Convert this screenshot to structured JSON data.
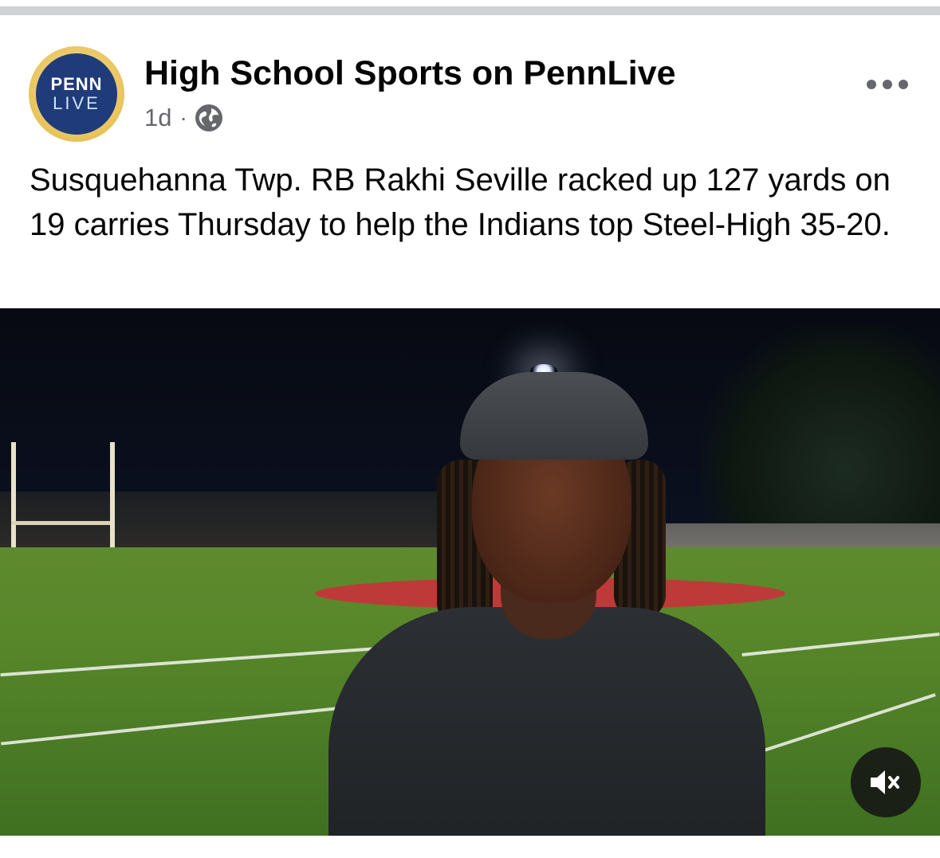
{
  "post": {
    "page_name": "High School Sports on PennLive",
    "timestamp": "1d",
    "separator": "·",
    "audience_icon": "globe-icon",
    "more_icon": "more-options-icon",
    "text": "Susquehanna Twp. RB Rakhi Seville racked up 127 yards on 19 carries Thursday to help the Indians top Steel-High 35-20."
  },
  "avatar": {
    "line1": "PENN",
    "line2": "LIVE",
    "colors": {
      "ring": "#e8c35a",
      "fill": "#1f3b7a"
    }
  },
  "video": {
    "mute_icon": "speaker-muted-icon",
    "muted": true
  },
  "colors": {
    "divider": "#cfd1d5",
    "primary_text": "#050505",
    "secondary_text": "#65676b"
  }
}
